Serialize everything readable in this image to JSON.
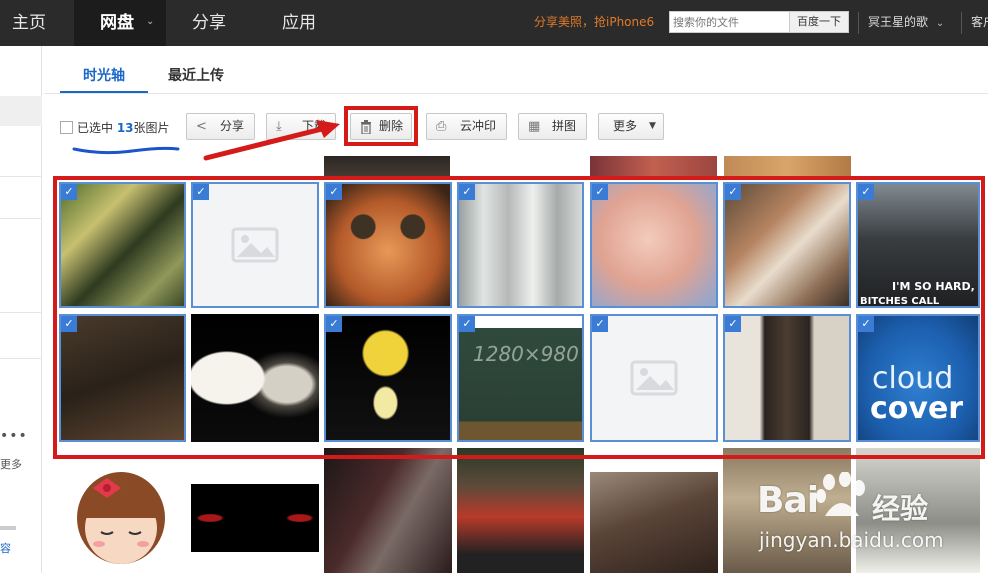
{
  "nav": {
    "items": [
      "主页",
      "网盘",
      "分享",
      "应用"
    ],
    "active_index": 1,
    "promo": "分享美照，抢iPhone6",
    "search_placeholder": "搜索你的文件",
    "search_button": "百度一下",
    "user": "冥王星的歌",
    "client": "客户端"
  },
  "sidebar": {
    "more_dots": "•••",
    "more_label": "更多",
    "capacity_link": "容"
  },
  "tabs": [
    {
      "label": "时光轴",
      "active": true
    },
    {
      "label": "最近上传",
      "active": false
    }
  ],
  "toolbar": {
    "selected_prefix": "已选中 ",
    "selected_count": "13",
    "selected_suffix": "张图片",
    "share": "分享",
    "download": "下载",
    "delete": "删除",
    "print": "云冲印",
    "collage": "拼图",
    "more": "更多"
  },
  "grid": {
    "rows": [
      {
        "label": "selected-row-1",
        "photos": [
          {
            "subject": "two men in vests singing",
            "selected": true
          },
          {
            "subject": "image placeholder",
            "selected": true,
            "empty": true
          },
          {
            "subject": "puss in boots kittens",
            "selected": true
          },
          {
            "subject": "glass jars",
            "selected": true
          },
          {
            "subject": "baby face",
            "selected": true
          },
          {
            "subject": "cats on bed",
            "selected": true
          },
          {
            "subject": "woman in car",
            "selected": true,
            "caption1": "I'M SO HARD,",
            "caption2": "BITCHES CALL"
          }
        ]
      },
      {
        "label": "selected-row-2",
        "photos": [
          {
            "subject": "dark room with chair",
            "selected": true
          },
          {
            "subject": "samoyed and husky",
            "selected": false
          },
          {
            "subject": "yellow cartoon dancer",
            "selected": true
          },
          {
            "subject": "chalkboard",
            "selected": true,
            "chalk": "1280×980"
          },
          {
            "subject": "image placeholder",
            "selected": true,
            "empty": true
          },
          {
            "subject": "man in doorway",
            "selected": true
          },
          {
            "subject": "cloud cover logo",
            "selected": true,
            "caption1": "cloud",
            "caption2": "cover"
          }
        ]
      },
      {
        "label": "unselected-row-3",
        "photos": [
          {
            "subject": "cartoon girl with bow"
          },
          {
            "subject": "red eyes in dark"
          },
          {
            "subject": "geisha painting"
          },
          {
            "subject": "man in red vest"
          },
          {
            "subject": "pirate kiss"
          },
          {
            "subject": "soldiers"
          },
          {
            "subject": "panda"
          }
        ]
      }
    ]
  },
  "watermark": {
    "logo_left": "Bai",
    "logo_right": "经验",
    "url": "jingyan.baidu.com"
  },
  "colors": {
    "accent": "#1b66c9",
    "annotation_red": "#d51a1a",
    "check_blue": "#3a7bd5",
    "nav_bg": "#2b2b2b",
    "promo": "#e07a2a"
  }
}
